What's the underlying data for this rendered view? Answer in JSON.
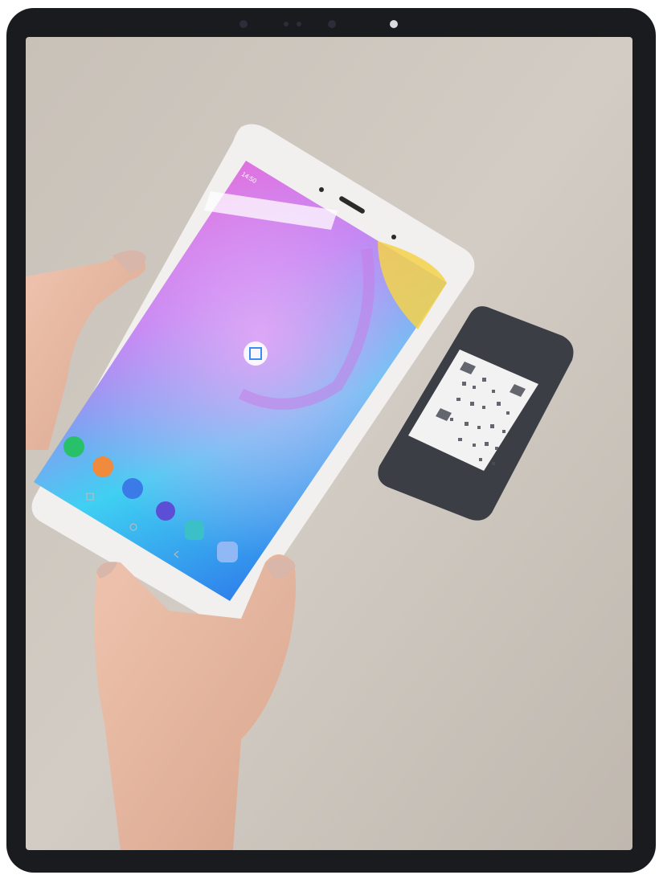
{
  "scene": {
    "kind": "photo-in-device-frame",
    "outer_frame_color": "#1a1b1f",
    "wall_color": "#c9c3bb",
    "skin_color": "#e7b9a3",
    "nail_color": "#d8b6a9",
    "tablet_bezel_color": "#f1f0ef",
    "phone_body_color": "#3c3e46"
  },
  "tablet_screen": {
    "status_text": "14:50",
    "wallpaper_colors": [
      "#f05ad0",
      "#b57af0",
      "#35c8f0",
      "#2a9ff0",
      "#3a6de8"
    ],
    "center_icon": "qr-scan-icon",
    "dock_icons": [
      "phone-icon",
      "contacts-icon",
      "messages-icon",
      "internet-icon",
      "calendar-icon",
      "apps-grid-icon"
    ],
    "nav_icons": [
      "recent-apps-icon",
      "home-icon",
      "back-icon"
    ]
  },
  "phone_screen": {
    "content": "qr-code-icon",
    "screen_color": "#f2f2f2"
  }
}
